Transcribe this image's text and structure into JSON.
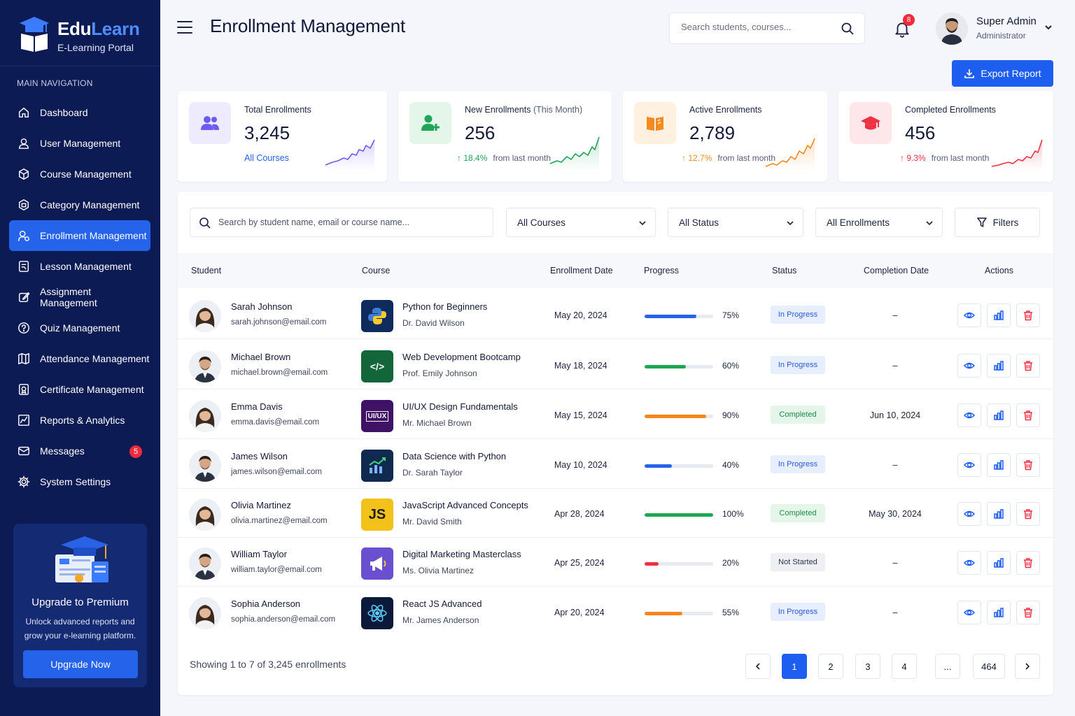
{
  "brand": {
    "name_a": "Edu",
    "name_b": "Learn",
    "tagline": "E-Learning Portal"
  },
  "nav": {
    "title": "MAIN NAVIGATION",
    "items": [
      {
        "label": "Dashboard",
        "icon": "home-icon"
      },
      {
        "label": "User Management",
        "icon": "user-icon"
      },
      {
        "label": "Course Management",
        "icon": "cube-icon"
      },
      {
        "label": "Category Management",
        "icon": "category-icon"
      },
      {
        "label": "Enrollment Management",
        "icon": "enroll-icon",
        "active": true
      },
      {
        "label": "Lesson Management",
        "icon": "lesson-icon"
      },
      {
        "label": "Assignment Management",
        "icon": "edit-icon"
      },
      {
        "label": "Quiz Management",
        "icon": "quiz-icon"
      },
      {
        "label": "Attendance Management",
        "icon": "attendance-icon"
      },
      {
        "label": "Certificate Management",
        "icon": "certificate-icon"
      },
      {
        "label": "Reports & Analytics",
        "icon": "chart-icon"
      },
      {
        "label": "Messages",
        "icon": "mail-icon",
        "badge": "5"
      },
      {
        "label": "System Settings",
        "icon": "gear-icon"
      }
    ]
  },
  "promo": {
    "title": "Upgrade to Premium",
    "desc": "Unlock advanced reports and grow your e-learning platform.",
    "button": "Upgrade Now"
  },
  "header": {
    "title": "Enrollment Management",
    "search_placeholder": "Search students, courses...",
    "notif_count": "8",
    "user_name": "Super Admin",
    "user_role": "Administrator",
    "export_label": "Export Report"
  },
  "stats": [
    {
      "label": "Total Enrollments",
      "label_sub": "",
      "value": "3,245",
      "link": "All Courses",
      "color": "#6d5bf5",
      "bg": "#eeebfe"
    },
    {
      "label": "New Enrollments",
      "label_sub": "(This Month)",
      "value": "256",
      "change": "18.4%",
      "change_text": "from last month",
      "color": "#22a45a",
      "bg": "#e4f6ea"
    },
    {
      "label": "Active Enrollments",
      "label_sub": "",
      "value": "2,789",
      "change": "12.7%",
      "change_text": "from last month",
      "color": "#f58a1f",
      "bg": "#fff0e0"
    },
    {
      "label": "Completed Enrollments",
      "label_sub": "",
      "value": "456",
      "change": "9.3%",
      "change_text": "from last month",
      "color": "#ee3344",
      "bg": "#fde7ea"
    }
  ],
  "filters": {
    "search_placeholder": "Search by student name, email or course name...",
    "course": "All Courses",
    "status": "All Status",
    "enrollments": "All Enrollments",
    "filters_label": "Filters"
  },
  "columns": [
    "Student",
    "Course",
    "Enrollment Date",
    "Progress",
    "Status",
    "Completion Date",
    "Actions"
  ],
  "rows": [
    {
      "name": "Sarah Johnson",
      "email": "sarah.johnson@email.com",
      "course": "Python for Beginners",
      "instructor": "Dr. David Wilson",
      "date": "May 20, 2024",
      "progress": 75,
      "progress_label": "75%",
      "status": "In Progress",
      "completion": "–",
      "course_icon": "python-icon",
      "course_bg": "#0f2a5c",
      "course_text": "",
      "gender": "f"
    },
    {
      "name": "Michael Brown",
      "email": "michael.brown@email.com",
      "course": "Web Development Bootcamp",
      "instructor": "Prof. Emily Johnson",
      "date": "May 18, 2024",
      "progress": 60,
      "progress_label": "60%",
      "status": "In Progress",
      "completion": "–",
      "course_icon": "code-icon",
      "course_bg": "#13653a",
      "course_text": "</>",
      "gender": "m"
    },
    {
      "name": "Emma Davis",
      "email": "emma.davis@email.com",
      "course": "UI/UX Design Fundamentals",
      "instructor": "Mr. Michael Brown",
      "date": "May 15, 2024",
      "progress": 90,
      "progress_label": "90%",
      "status": "Completed",
      "completion": "Jun 10, 2024",
      "course_icon": "uiux-icon",
      "course_bg": "#3f1266",
      "course_text": "UI/UX",
      "gender": "f"
    },
    {
      "name": "James Wilson",
      "email": "james.wilson@email.com",
      "course": "Data Science with Python",
      "instructor": "Dr. Sarah Taylor",
      "date": "May 10, 2024",
      "progress": 40,
      "progress_label": "40%",
      "status": "In Progress",
      "completion": "–",
      "course_icon": "data-chart-icon",
      "course_bg": "#0f2a4e",
      "course_text": "",
      "gender": "m"
    },
    {
      "name": "Olivia Martinez",
      "email": "olivia.martinez@email.com",
      "course": "JavaScript Advanced Concepts",
      "instructor": "Mr. David Smith",
      "date": "Apr 28, 2024",
      "progress": 100,
      "progress_label": "100%",
      "status": "Completed",
      "completion": "May 30, 2024",
      "course_icon": "js-icon",
      "course_bg": "#f2c21a",
      "course_text": "JS",
      "gender": "f"
    },
    {
      "name": "William Taylor",
      "email": "william.taylor@email.com",
      "course": "Digital Marketing Masterclass",
      "instructor": "Ms. Olivia Martinez",
      "date": "Apr 25, 2024",
      "progress": 20,
      "progress_label": "20%",
      "status": "Not Started",
      "completion": "–",
      "course_icon": "megaphone-icon",
      "course_bg": "#6a4fcf",
      "course_text": "",
      "gender": "m"
    },
    {
      "name": "Sophia Anderson",
      "email": "sophia.anderson@email.com",
      "course": "React JS Advanced",
      "instructor": "Mr. James Anderson",
      "date": "Apr 20, 2024",
      "progress": 55,
      "progress_label": "55%",
      "status": "In Progress",
      "completion": "–",
      "course_icon": "react-icon",
      "course_bg": "#0c1a3a",
      "course_text": "",
      "gender": "f"
    }
  ],
  "pagination": {
    "showing": "Showing 1 to 7 of 3,245 enrollments",
    "pages": [
      "1",
      "2",
      "3",
      "4",
      "...",
      "464"
    ],
    "current": "1"
  },
  "colors": {
    "accent": "#1d5ef0",
    "sidebar": "#0d1b54",
    "blue": "#2563eb",
    "green": "#1fa653",
    "orange": "#f7841f",
    "red": "#ee2f44"
  }
}
